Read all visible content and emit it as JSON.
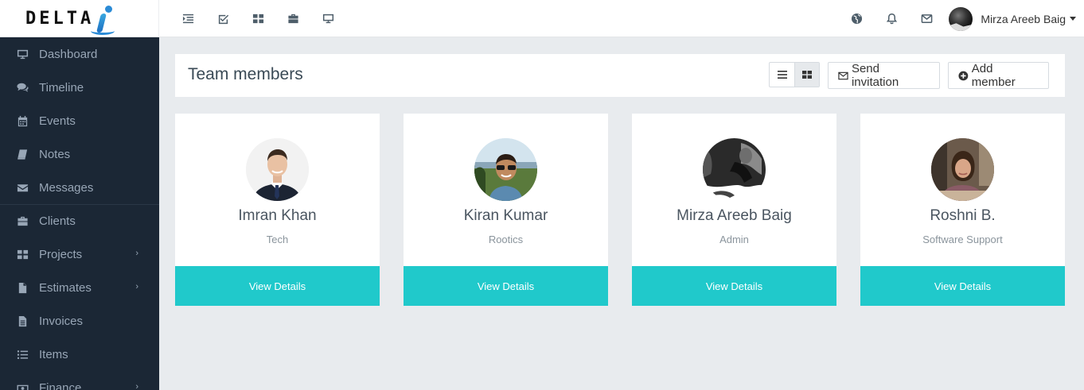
{
  "brand": {
    "logo_text": "DELTA",
    "logo_mark": "i"
  },
  "topbar": {
    "left_icons": [
      "menu-indent-icon",
      "checkbox-icon",
      "grid-icon",
      "briefcase-icon",
      "monitor-icon"
    ],
    "right_icons": [
      "globe-icon",
      "bell-icon",
      "mail-icon"
    ],
    "user_name": "Mirza Areeb Baig"
  },
  "sidebar": {
    "items": [
      {
        "label": "Dashboard",
        "icon": "monitor-icon"
      },
      {
        "label": "Timeline",
        "icon": "comments-icon"
      },
      {
        "label": "Events",
        "icon": "calendar-icon"
      },
      {
        "label": "Notes",
        "icon": "book-icon"
      },
      {
        "label": "Messages",
        "icon": "envelope-icon"
      },
      {
        "label": "Clients",
        "icon": "briefcase-icon"
      },
      {
        "label": "Projects",
        "icon": "grid-icon",
        "submenu": true
      },
      {
        "label": "Estimates",
        "icon": "file-icon",
        "submenu": true
      },
      {
        "label": "Invoices",
        "icon": "file-text-icon"
      },
      {
        "label": "Items",
        "icon": "list-icon"
      },
      {
        "label": "Finance",
        "icon": "money-icon",
        "submenu": true
      }
    ]
  },
  "header": {
    "title": "Team members",
    "send_invitation_label": "Send invitation",
    "add_member_label": "Add member"
  },
  "members": [
    {
      "name": "Imran Khan",
      "role": "Tech",
      "button": "View Details"
    },
    {
      "name": "Kiran Kumar",
      "role": "Rootics",
      "button": "View Details"
    },
    {
      "name": "Mirza Areeb Baig",
      "role": "Admin",
      "button": "View Details"
    },
    {
      "name": "Roshni B.",
      "role": "Software Support",
      "button": "View Details"
    }
  ],
  "colors": {
    "accent": "#20c9cb",
    "sidebar_bg": "#1b2735",
    "page_bg": "#e8ebee"
  }
}
